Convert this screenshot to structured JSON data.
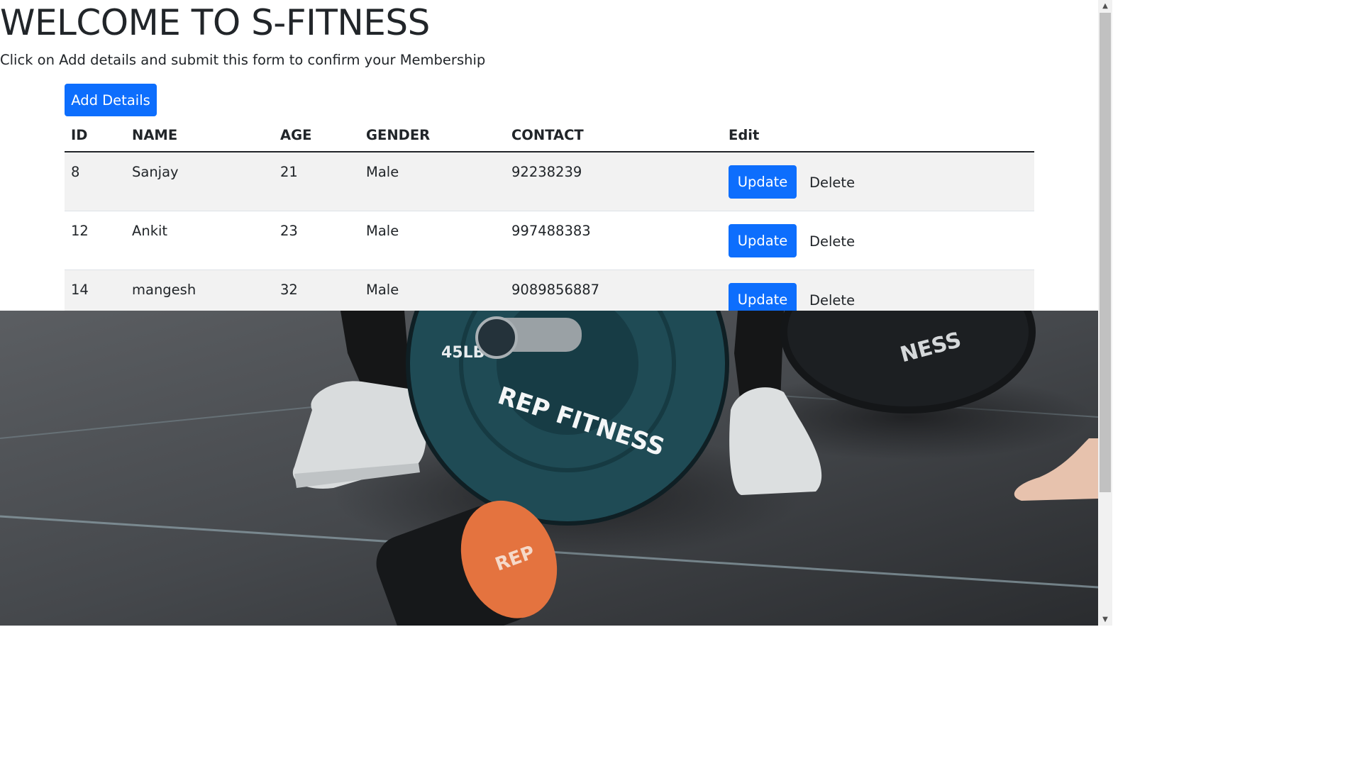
{
  "header": {
    "title": "WELCOME TO S-FITNESS",
    "subtitle": "Click on Add details and submit this form to confirm your Membership"
  },
  "actions": {
    "add_details_label": "Add Details"
  },
  "table": {
    "columns": [
      "ID",
      "NAME",
      "AGE",
      "GENDER",
      "CONTACT",
      "Edit"
    ],
    "rows": [
      {
        "id": "8",
        "name": "Sanjay",
        "age": "21",
        "gender": "Male",
        "contact": "92238239",
        "update_label": "Update",
        "delete_label": "Delete"
      },
      {
        "id": "12",
        "name": "Ankit",
        "age": "23",
        "gender": "Male",
        "contact": "997488383",
        "update_label": "Update",
        "delete_label": "Delete"
      },
      {
        "id": "14",
        "name": "mangesh",
        "age": "32",
        "gender": "Male",
        "contact": "9089856887",
        "update_label": "Update",
        "delete_label": "Delete"
      }
    ]
  },
  "hero_image": {
    "plate_text_main": "REP FITNESS",
    "plate_weight": "45LB",
    "plate_text_right": "NESS",
    "roller_text": "REP"
  },
  "colors": {
    "primary": "#0d6efd",
    "text": "#212529",
    "striped_row": "#f2f2f2",
    "plate": "#1f4b55"
  },
  "icons": {
    "scroll_up": "arrow-up-icon",
    "scroll_down": "arrow-down-icon"
  }
}
